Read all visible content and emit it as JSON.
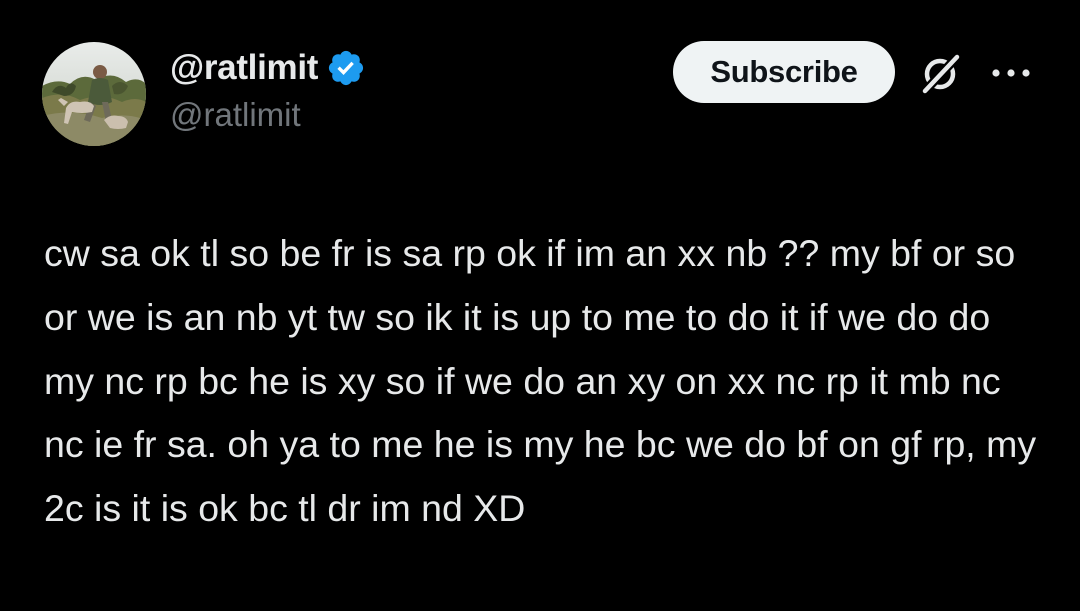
{
  "post": {
    "author": {
      "display_name": "@ratlimit",
      "handle": "@ratlimit",
      "verified": true,
      "verified_icon": "verified-badge-icon",
      "avatar_icon": "avatar-photo"
    },
    "actions": {
      "subscribe_label": "Subscribe",
      "grok_icon": "grok-slash-icon",
      "more_icon": "more-dots-icon"
    },
    "text": "cw sa ok tl so be fr is sa rp ok if im an xx nb ?? my bf or so or we is an nb yt tw so ik it is up to me to do it if we do do my nc rp bc he is xy so if we do an xy on xx nc rp it mb nc nc ie fr sa. oh ya to me he is my he bc we do bf on gf rp, my 2c is it is ok bc tl dr im nd XD"
  },
  "theme": {
    "background": "#000000",
    "text_primary": "#e7e9ea",
    "text_secondary": "#71767b",
    "verified_blue": "#1d9bf0",
    "button_bg": "#eff3f4",
    "button_text": "#0f1419"
  }
}
